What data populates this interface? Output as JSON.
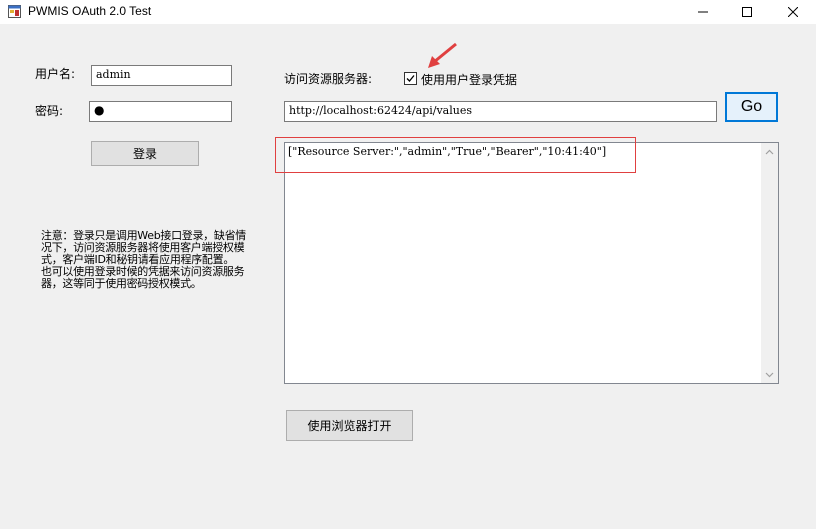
{
  "window": {
    "title": "PWMIS OAuth 2.0 Test"
  },
  "login": {
    "username_label": "用户名:",
    "username_value": "admin",
    "password_label": "密码:",
    "password_masked": "●",
    "login_button": "登录"
  },
  "resource": {
    "server_label": "访问资源服务器:",
    "use_credentials_label": "使用用户登录凭据",
    "use_credentials_checked": true,
    "url_value": "http://localhost:62424/api/values",
    "go_button": "Go",
    "result_text": "[\"Resource Server:\",\"admin\",\"True\",\"Bearer\",\"10:41:40\"]",
    "open_browser_button": "使用浏览器打开"
  },
  "note": {
    "paragraph1": "注意：登录只是调用Web接口登录，缺省情况下，访问资源服务器将使用客户端授权模式，客户端ID和秘钥请看应用程序配置。",
    "paragraph2": "也可以使用登录时候的凭据来访问资源服务器，这等同于使用密码授权模式。"
  },
  "colors": {
    "accent": "#0078d7",
    "annotation_red": "#e04040"
  }
}
